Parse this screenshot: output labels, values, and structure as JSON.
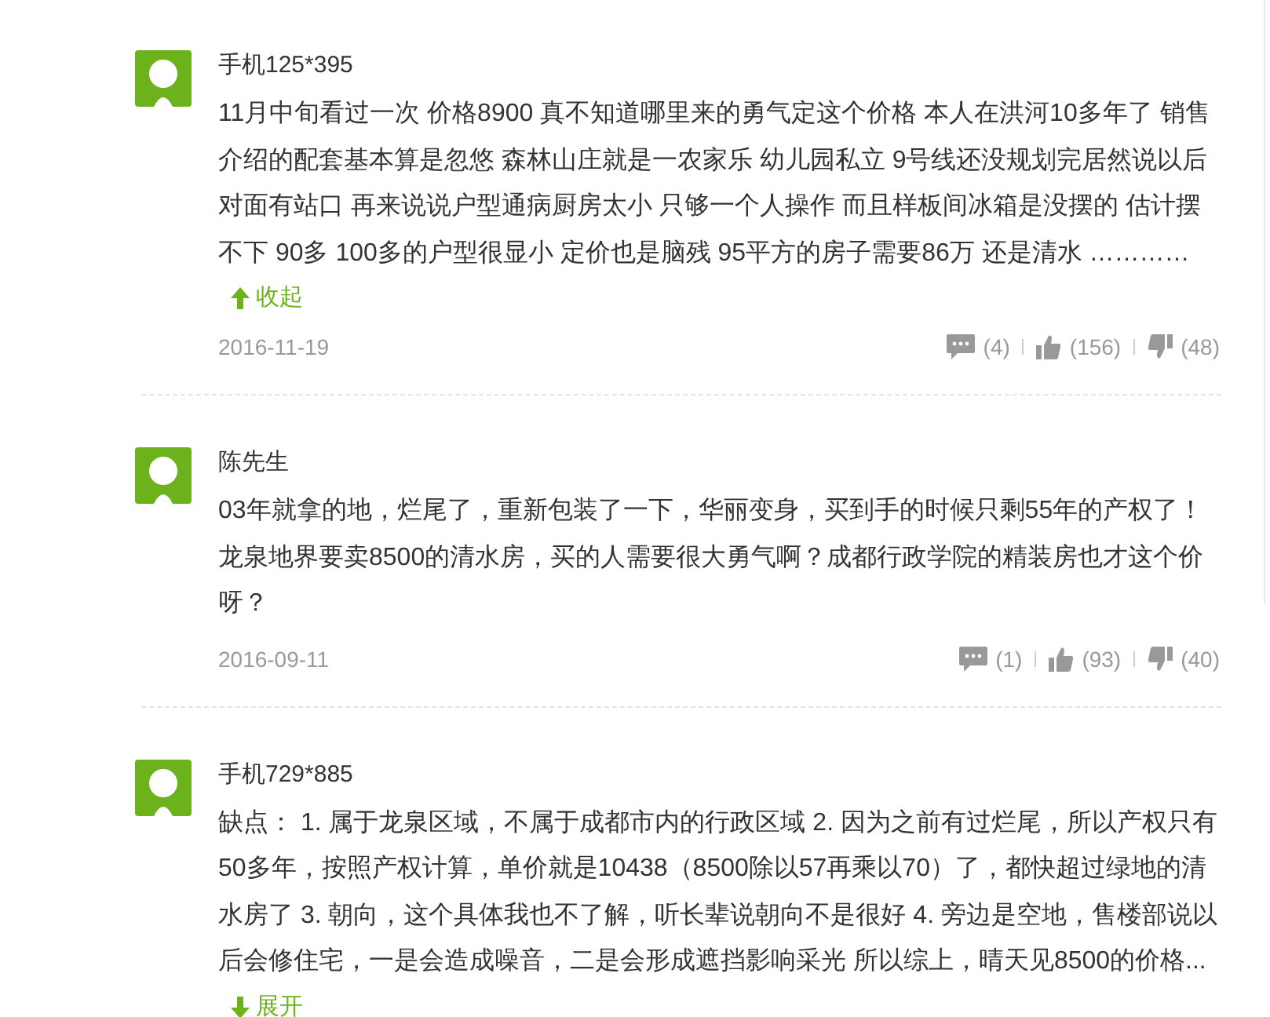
{
  "comments": [
    {
      "user": "手机125*395",
      "text": "11月中旬看过一次 价格8900 真不知道哪里来的勇气定这个价格 本人在洪河10多年了 销售介绍的配套基本算是忽悠 森林山庄就是一农家乐 幼儿园私立 9号线还没规划完居然说以后对面有站口 再来说说户型通病厨房太小 只够一个人操作 而且样板间冰箱是没摆的 估计摆不下 90多 100多的户型很显小 定价也是脑残 95平方的房子需要86万 还是清水 …………",
      "toggle": {
        "label": "收起",
        "expanded": true
      },
      "date": "2016-11-19",
      "replies": "(4)",
      "likes": "(156)",
      "dislikes": "(48)"
    },
    {
      "user": "陈先生",
      "text": "03年就拿的地，烂尾了，重新包装了一下，华丽变身，买到手的时候只剩55年的产权了！龙泉地界要卖8500的清水房，买的人需要很大勇气啊？成都行政学院的精装房也才这个价呀？",
      "date": "2016-09-11",
      "replies": "(1)",
      "likes": "(93)",
      "dislikes": "(40)"
    },
    {
      "user": "手机729*885",
      "text": "缺点： 1. 属于龙泉区域，不属于成都市内的行政区域 2. 因为之前有过烂尾，所以产权只有50多年，按照产权计算，单价就是10438（8500除以57再乘以70）了，都快超过绿地的清水房了 3. 朝向，这个具体我也不了解，听长辈说朝向不是很好 4. 旁边是空地，售楼部说以后会修住宅，一是会造成噪音，二是会形成遮挡影响采光 所以综上，晴天见8500的价格...",
      "toggle": {
        "label": "展开",
        "expanded": false
      }
    }
  ]
}
